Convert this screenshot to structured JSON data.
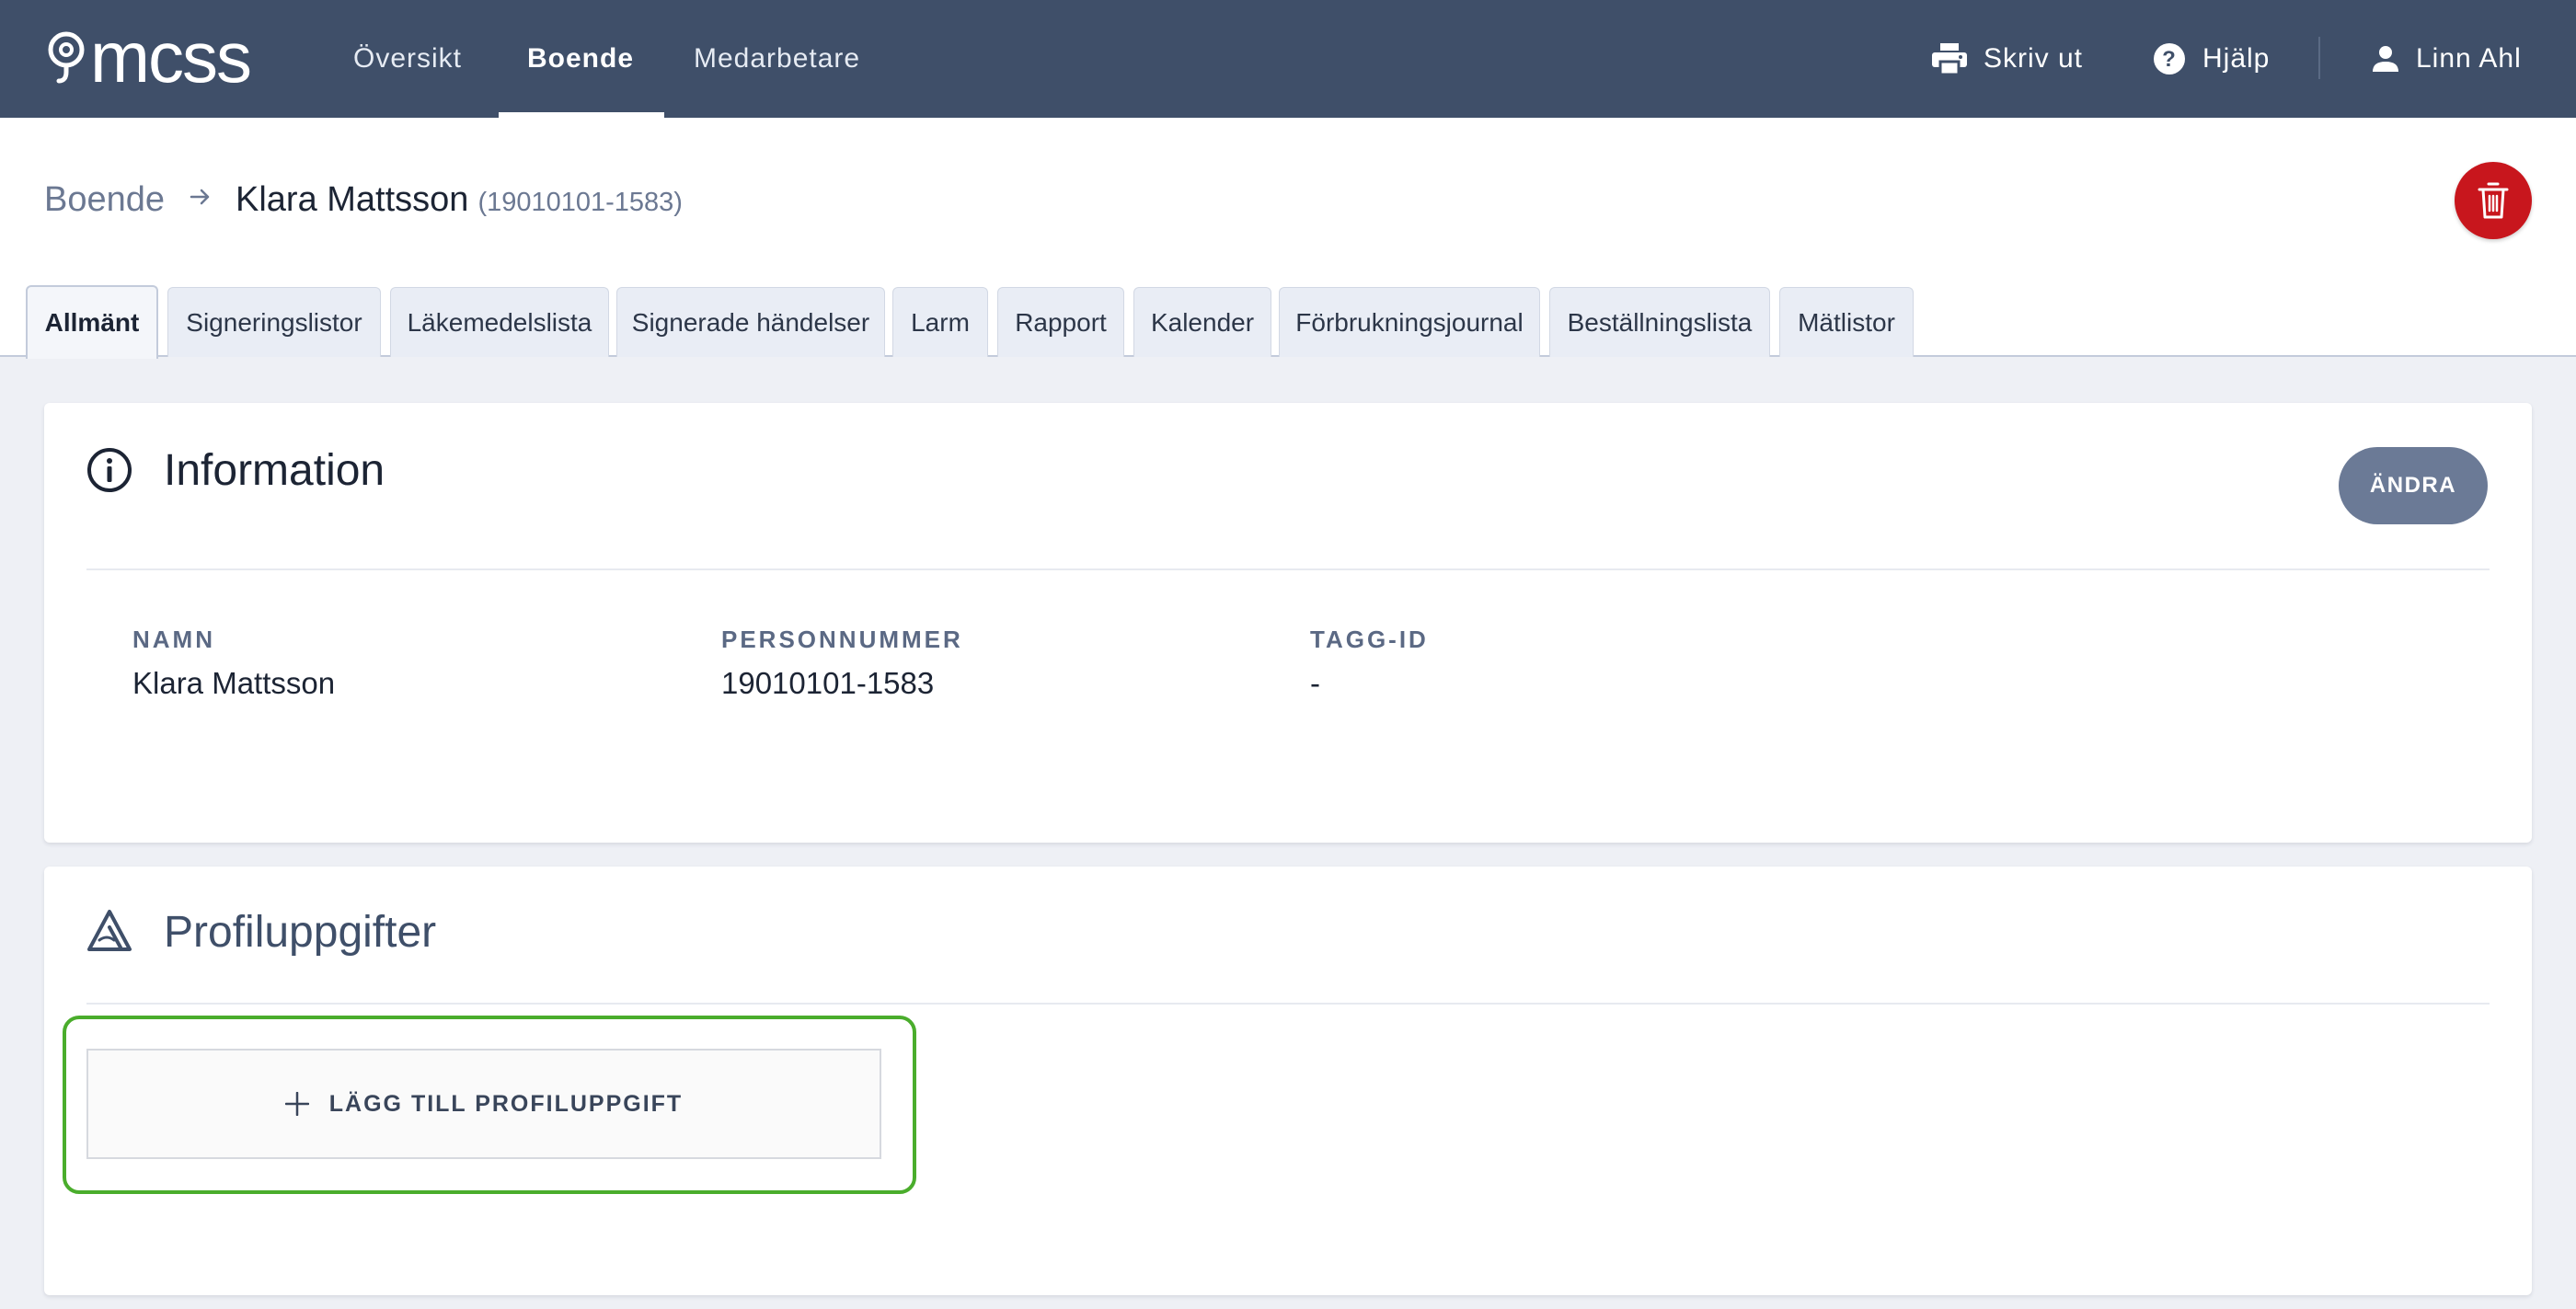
{
  "app": {
    "logo_text": "mcss"
  },
  "nav": {
    "items": [
      {
        "label": "Översikt"
      },
      {
        "label": "Boende"
      },
      {
        "label": "Medarbetare"
      }
    ],
    "print_label": "Skriv ut",
    "help_label": "Hjälp",
    "user_name": "Linn Ahl"
  },
  "breadcrumb": {
    "root": "Boende",
    "name": "Klara Mattsson",
    "personnummer": "(19010101-1583)"
  },
  "tabs": [
    {
      "label": "Allmänt"
    },
    {
      "label": "Signeringslistor"
    },
    {
      "label": "Läkemedelslista"
    },
    {
      "label": "Signerade händelser"
    },
    {
      "label": "Larm"
    },
    {
      "label": "Rapport"
    },
    {
      "label": "Kalender"
    },
    {
      "label": "Förbrukningsjournal"
    },
    {
      "label": "Beställningslista"
    },
    {
      "label": "Mätlistor"
    }
  ],
  "information": {
    "title": "Information",
    "edit_label": "ÄNDRA",
    "fields": [
      {
        "label": "NAMN",
        "value": "Klara Mattsson"
      },
      {
        "label": "PERSONNUMMER",
        "value": "19010101-1583"
      },
      {
        "label": "TAGG-ID",
        "value": "-"
      }
    ]
  },
  "profile": {
    "title": "Profiluppgifter",
    "add_label": "LÄGG TILL PROFILUPPGIFT"
  },
  "icons": {
    "logo": "stethoscope-logo-icon",
    "print": "printer-icon",
    "help": "help-circle-icon",
    "user": "person-icon",
    "breadcrumb_separator": "arrow-right-icon",
    "delete": "trash-icon",
    "information": "info-circle-icon",
    "profile": "profile-triangle-icon",
    "add": "plus-icon"
  },
  "colors": {
    "topbar": "#3f4f69",
    "delete": "#c8161d",
    "edit_button": "#6b7a96",
    "highlight": "#4aad2c"
  }
}
